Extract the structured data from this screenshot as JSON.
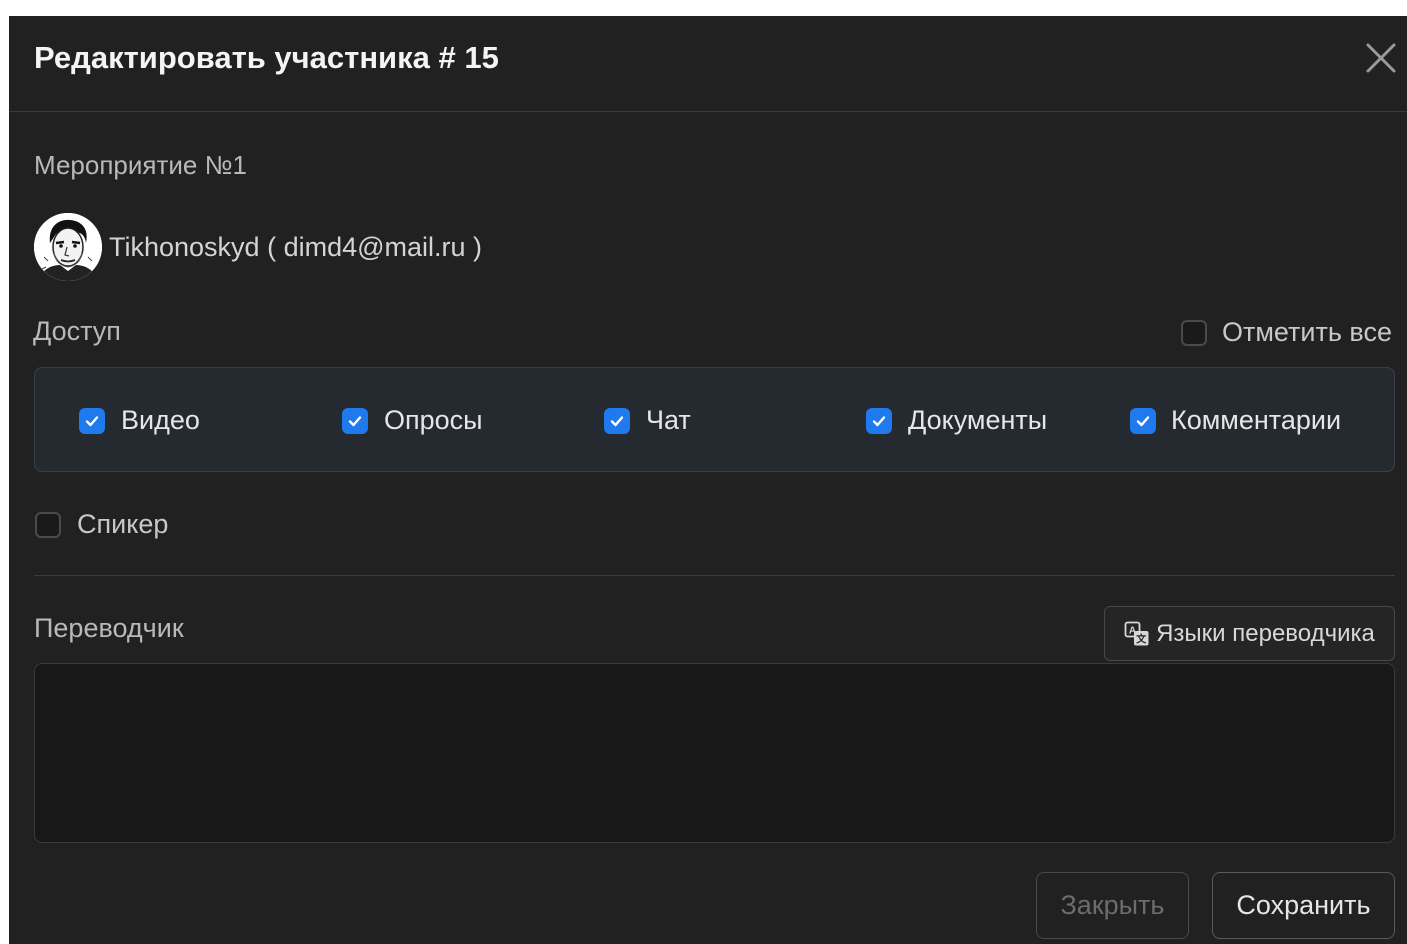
{
  "modal": {
    "title": "Редактировать участника # 15",
    "close_icon": "close-icon"
  },
  "event": {
    "name": "Мероприятие №1"
  },
  "user": {
    "display": "Tikhonoskyd ( dimd4@mail.ru )",
    "avatar_icon": "user-avatar"
  },
  "access": {
    "label": "Доступ",
    "select_all": {
      "label": "Отметить все",
      "checked": false
    },
    "items": [
      {
        "label": "Видео",
        "checked": true
      },
      {
        "label": "Опросы",
        "checked": true
      },
      {
        "label": "Чат",
        "checked": true
      },
      {
        "label": "Документы",
        "checked": true
      },
      {
        "label": "Комментарии",
        "checked": true
      }
    ]
  },
  "speaker": {
    "label": "Спикер",
    "checked": false
  },
  "translator": {
    "label": "Переводчик",
    "languages_button": "Языки переводчика",
    "languages_icon": "translate-icon",
    "value": ""
  },
  "footer": {
    "close_label": "Закрыть",
    "save_label": "Сохранить"
  },
  "colors": {
    "modal_bg": "#212121",
    "access_bg": "#252930",
    "checkbox_accent": "#1f7aed"
  }
}
